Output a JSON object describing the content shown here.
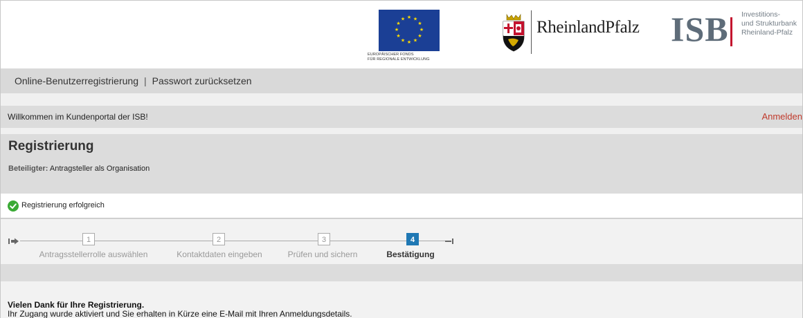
{
  "logos": {
    "eu_line1": "EUROPÄISCHER FONDS",
    "eu_line2": "FÜR REGIONALE ENTWICKLUNG",
    "rlp_name": "RheinlandPfalz",
    "isb_word": "ISB",
    "isb_sub": [
      "Investitions-",
      "und Strukturbank",
      "Rheinland-Pfalz"
    ]
  },
  "nav": {
    "links": [
      "Online-Benutzerregistrierung",
      "Passwort zurücksetzen"
    ],
    "separator": "|"
  },
  "welcome": {
    "text": "Willkommen im Kundenportal der ISB!",
    "login_label": "Anmelden"
  },
  "page": {
    "title": "Registrierung",
    "participant_label": "Beteiligter:",
    "participant_value": "Antragsteller als Organisation"
  },
  "status": {
    "message": "Registrierung erfolgreich",
    "icon": "check-circle-icon",
    "color": "#3aaa35"
  },
  "steps": [
    {
      "number": "1",
      "label": "Antragsstellerrolle auswählen",
      "active": false
    },
    {
      "number": "2",
      "label": "Kontaktdaten eingeben",
      "active": false
    },
    {
      "number": "3",
      "label": "Prüfen und sichern",
      "active": false
    },
    {
      "number": "4",
      "label": "Bestätigung",
      "active": true
    }
  ],
  "confirmation": {
    "title": "Vielen Dank für Ihre Registrierung.",
    "text": "Ihr Zugang wurde aktiviert und Sie erhalten in Kürze eine E-Mail mit Ihren Anmeldungsdetails."
  },
  "colors": {
    "accent": "#1f78b4",
    "login_link": "#c0392b",
    "isb_red": "#c3122e",
    "eu_blue": "#1b3f95"
  }
}
